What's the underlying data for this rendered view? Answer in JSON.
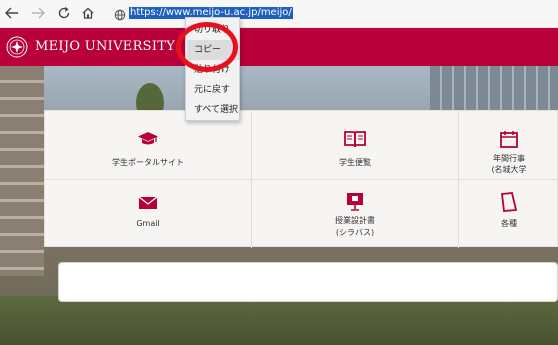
{
  "browser": {
    "url": "https://www.meijo-u.ac.jp/meijo/",
    "nav_icons": [
      "back-arrow-icon",
      "forward-arrow-icon",
      "refresh-icon",
      "home-icon",
      "globe-icon"
    ]
  },
  "header": {
    "title": "MEIJO UNIVERSITY",
    "brand_color": "#b8003b"
  },
  "services": {
    "row1": [
      {
        "label": "学生ポータルサイト",
        "icon": "graduation-cap-icon"
      },
      {
        "label": "学生便覧",
        "icon": "open-book-icon"
      },
      {
        "label_line1": "年間行事",
        "label_line2": "(名城大学",
        "icon": "calendar-icon"
      }
    ],
    "row2": [
      {
        "label": "Gmail",
        "icon": "envelope-icon"
      },
      {
        "label_line1": "授業設計書",
        "label_line2": "(シラバス)",
        "icon": "monitor-icon"
      },
      {
        "label": "各種",
        "icon": "document-icon"
      }
    ],
    "icon_color": "#b8003b"
  },
  "context_menu": {
    "items": [
      "切り取り",
      "コピー",
      "貼り付け",
      "元に戻す",
      "すべて選択"
    ],
    "highlighted_index": 1
  },
  "annotation": {
    "ring_color": "#e8101e"
  }
}
